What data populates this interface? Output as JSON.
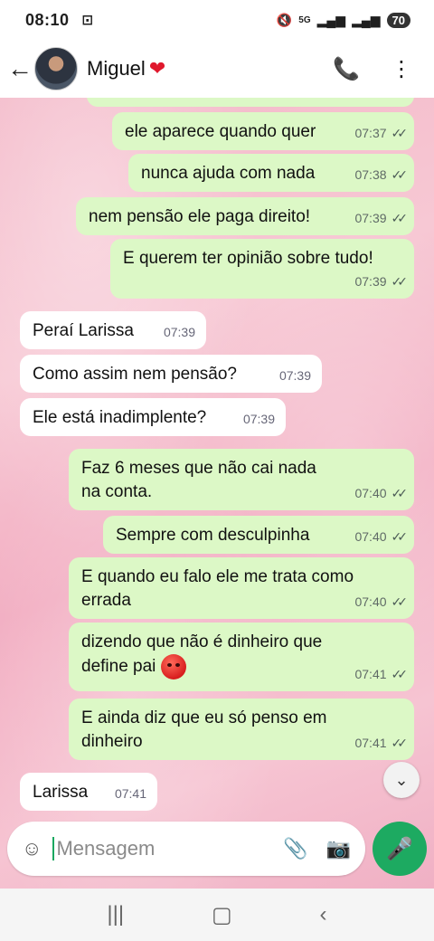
{
  "status_bar": {
    "time": "08:10",
    "battery": "70",
    "network": "5G"
  },
  "header": {
    "contact_name": "Miguel",
    "heart": "❤"
  },
  "messages": [
    {
      "dir": "out",
      "text": "ele aparece quando quer",
      "time": "07:37"
    },
    {
      "dir": "out",
      "text": "nunca ajuda com nada",
      "time": "07:38"
    },
    {
      "dir": "out",
      "text": "nem pensão ele paga direito!",
      "time": "07:39"
    },
    {
      "dir": "out",
      "text": "E querem ter opinião sobre tudo!",
      "time": "07:39"
    },
    {
      "dir": "in",
      "text": "Peraí Larissa",
      "time": "07:39"
    },
    {
      "dir": "in",
      "text": "Como assim nem pensão?",
      "time": "07:39"
    },
    {
      "dir": "in",
      "text": "Ele está inadimplente?",
      "time": "07:39"
    },
    {
      "dir": "out",
      "text": "Faz 6 meses que não cai nada na conta.",
      "time": "07:40"
    },
    {
      "dir": "out",
      "text": "Sempre com desculpinha",
      "time": "07:40"
    },
    {
      "dir": "out",
      "text": "E quando eu falo ele me trata como errada",
      "time": "07:40"
    },
    {
      "dir": "out",
      "text": "dizendo que não é dinheiro que define pai",
      "time": "07:41",
      "emoji": "angry-face"
    },
    {
      "dir": "out",
      "text": "E ainda diz que eu só penso em dinheiro",
      "time": "07:41"
    },
    {
      "dir": "in",
      "text": "Larissa",
      "time": "07:41"
    }
  ],
  "composer": {
    "placeholder": "Mensagem"
  },
  "colors": {
    "outgoing_bubble": "#dcf8c6",
    "incoming_bubble": "#ffffff",
    "mic_button": "#1daa61"
  }
}
